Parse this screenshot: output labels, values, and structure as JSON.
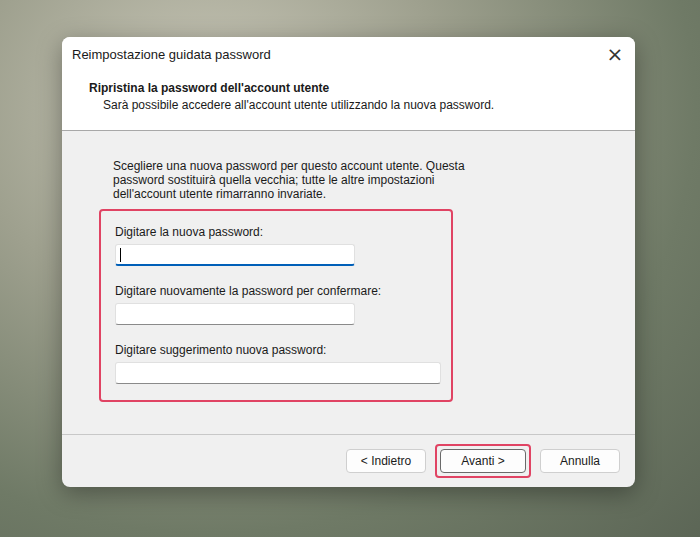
{
  "window": {
    "title": "Reimpostazione guidata password",
    "close": "×"
  },
  "header": {
    "title": "Ripristina la password dell'account utente",
    "subtitle": "Sarà possibile accedere all'account utente utilizzando la nuova password."
  },
  "instructions": "Scegliere una nuova password per questo account utente. Questa password sostituirà quella vecchia; tutte le altre impostazioni dell'account utente rimarranno invariate.",
  "fields_highlighted": true,
  "fields": [
    {
      "label": "Digitare la nuova password:",
      "value": "",
      "focused": true,
      "kind": "short"
    },
    {
      "label": "Digitare nuovamente la password per confermare:",
      "value": "",
      "focused": false,
      "kind": "short"
    },
    {
      "label": "Digitare suggerimento nuova password:",
      "value": "",
      "focused": false,
      "kind": "wide"
    }
  ],
  "buttons": [
    {
      "label": "< Indietro",
      "default": false,
      "highlighted": false
    },
    {
      "label": "Avanti >",
      "default": true,
      "highlighted": true
    },
    {
      "label": "Annulla",
      "default": false,
      "highlighted": false
    }
  ]
}
